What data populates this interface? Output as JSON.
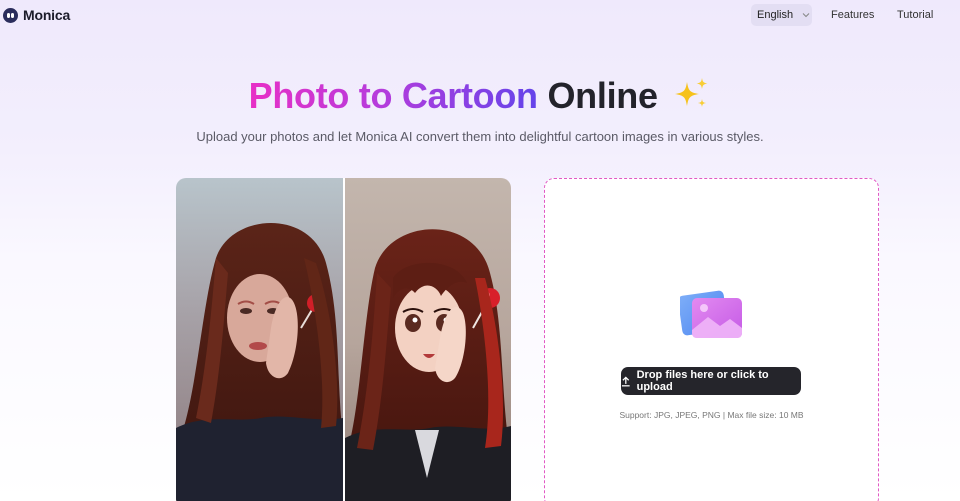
{
  "header": {
    "logo_text": "Monica",
    "language": "English",
    "nav": [
      {
        "label": "Features"
      },
      {
        "label": "Tutorial"
      }
    ]
  },
  "hero": {
    "title_gradient": "Photo to Cartoon",
    "title_plain": "Online",
    "title_emoji_icon": "sparkles-icon",
    "subtitle": "Upload your photos and let Monica AI convert them into delightful cartoon images in various styles."
  },
  "upload": {
    "button_label": "Drop files here or click to upload",
    "support_text": "Support: JPG, JPEG, PNG | Max file size: 10 MB"
  },
  "colors": {
    "accent_pink": "#e82fc6",
    "accent_purple": "#6444ea",
    "dashed_border": "#e259c5",
    "button_dark": "#25252b"
  }
}
